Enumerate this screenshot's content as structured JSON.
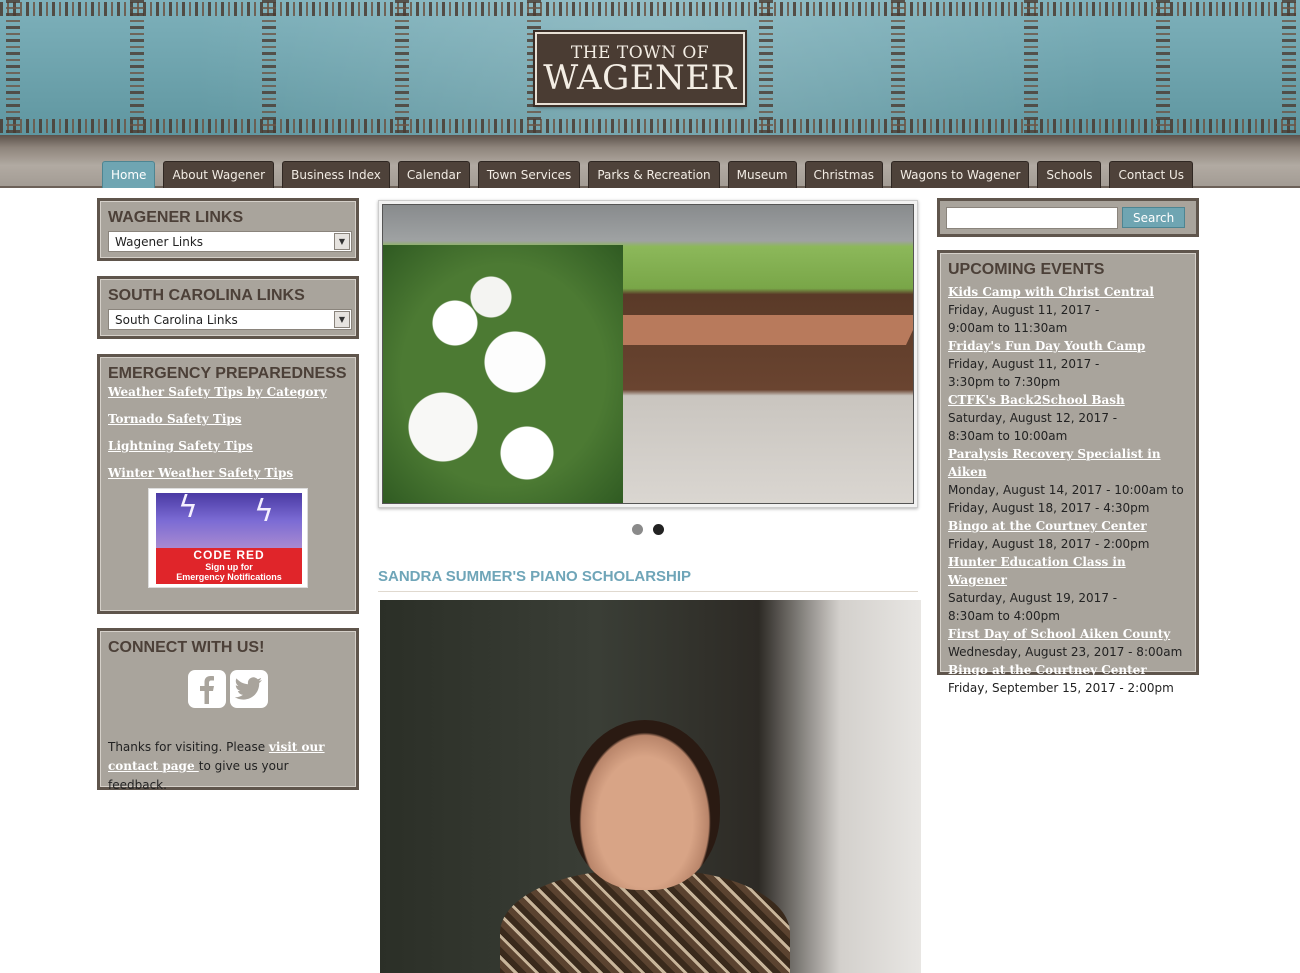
{
  "header": {
    "logo_top": "THE TOWN OF",
    "logo_main": "WAGENER"
  },
  "nav": {
    "items": [
      {
        "label": "Home",
        "active": true
      },
      {
        "label": "About Wagener"
      },
      {
        "label": "Business Index"
      },
      {
        "label": "Calendar"
      },
      {
        "label": "Town Services"
      },
      {
        "label": "Parks & Recreation"
      },
      {
        "label": "Museum"
      },
      {
        "label": "Christmas"
      },
      {
        "label": "Wagons to Wagener"
      },
      {
        "label": "Schools"
      },
      {
        "label": "Contact Us"
      }
    ]
  },
  "left": {
    "wagener_links": {
      "title": "WAGENER LINKS",
      "selected": "Wagener Links"
    },
    "sc_links": {
      "title": "SOUTH CAROLINA LINKS",
      "selected": "South Carolina Links"
    },
    "emergency": {
      "title": "EMERGENCY PREPAREDNESS",
      "links": [
        "Weather Safety Tips by Category",
        "Tornado Safety Tips",
        "Lightning Safety Tips",
        "Winter Weather Safety Tips"
      ],
      "codered_title": "CODE RED",
      "codered_sub1": "Sign up for",
      "codered_sub2": "Emergency Notifications"
    },
    "connect": {
      "title": "CONNECT WITH US!",
      "text_before": "Thanks for visiting. Please ",
      "link": "visit our contact page ",
      "text_after": "to give us your feedback."
    }
  },
  "main": {
    "slider_dots": 2,
    "active_dot": 2,
    "article_title": "SANDRA SUMMER'S PIANO SCHOLARSHIP"
  },
  "right": {
    "search": {
      "placeholder": "",
      "button": "Search"
    },
    "events": {
      "title": "UPCOMING EVENTS",
      "items": [
        {
          "title": "Kids Camp with Christ Central",
          "date1": "Friday, August 11, 2017 -",
          "date2": "9:00am to 11:30am"
        },
        {
          "title": "Friday's Fun Day Youth Camp",
          "date1": "Friday, August 11, 2017 -",
          "date2": "3:30pm to 7:30pm"
        },
        {
          "title": "CTFK's Back2School Bash",
          "date1": "Saturday, August 12, 2017 -",
          "date2": "8:30am to 10:00am"
        },
        {
          "title": "Paralysis Recovery Specialist in Aiken",
          "date1": "Monday, August 14, 2017 - 10:00am to",
          "date2": "Friday, August 18, 2017 - 4:30pm"
        },
        {
          "title": "Bingo at the Courtney Center",
          "date1": "Friday, August 18, 2017 - 2:00pm",
          "date2": ""
        },
        {
          "title": "Hunter Education Class in Wagener",
          "date1": "Saturday, August 19, 2017 -",
          "date2": "8:30am to 4:00pm"
        },
        {
          "title": "First Day of School Aiken County",
          "date1": "Wednesday, August 23, 2017 - 8:00am",
          "date2": ""
        },
        {
          "title": "Bingo at the Courtney Center",
          "date1": "Friday, September 15, 2017 - 2:00pm",
          "date2": ""
        }
      ]
    }
  }
}
